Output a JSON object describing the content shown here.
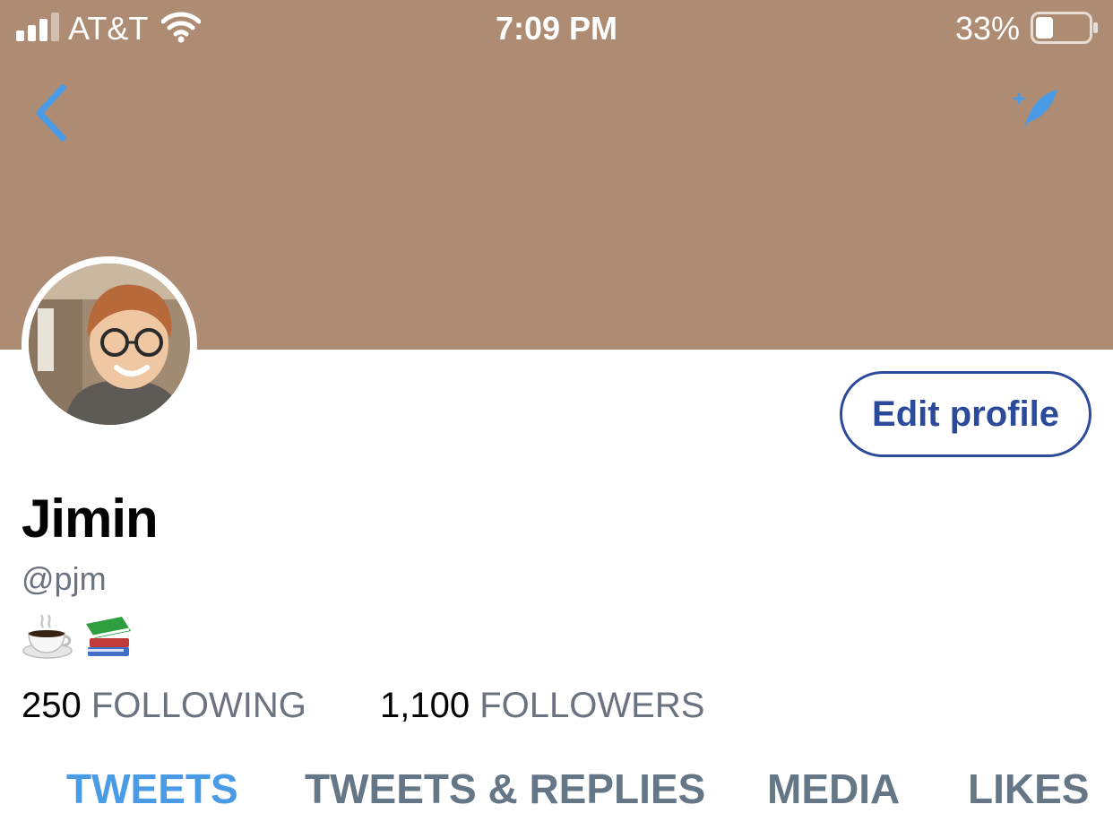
{
  "status_bar": {
    "carrier": "AT&T",
    "time": "7:09 PM",
    "battery_percent": "33%",
    "battery_level": 0.33,
    "signal_icon": "signal-bars-icon",
    "wifi_icon": "wifi-icon"
  },
  "nav": {
    "back_icon": "chevron-left-icon",
    "compose_icon": "compose-quill-icon"
  },
  "colors": {
    "banner": "#ad8c73",
    "accent": "#4a9be6",
    "edit_button": "#2c4a9a",
    "secondary_text": "#6b7280"
  },
  "profile": {
    "name": "Jimin",
    "handle": "@pjm",
    "bio_icons": [
      "coffee-icon",
      "books-icon"
    ],
    "edit_button_label": "Edit profile",
    "following_count": "250",
    "following_label": "FOLLOWING",
    "followers_count": "1,100",
    "followers_label": "FOLLOWERS"
  },
  "tabs": [
    {
      "label": "TWEETS",
      "active": true
    },
    {
      "label": "TWEETS & REPLIES",
      "active": false
    },
    {
      "label": "MEDIA",
      "active": false
    },
    {
      "label": "LIKES",
      "active": false
    }
  ]
}
